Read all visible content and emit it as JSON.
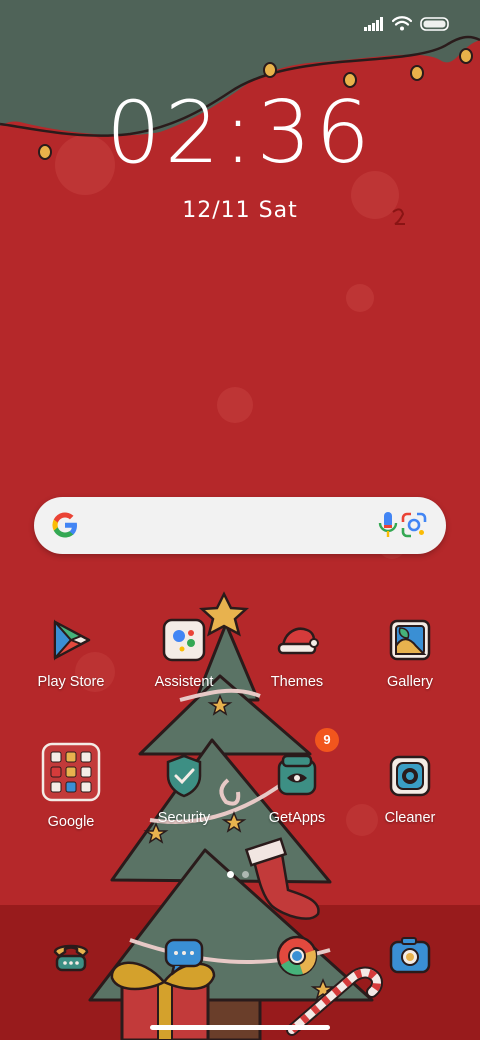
{
  "colors": {
    "wallpaper_red": "#b5282a",
    "wallpaper_dark_red": "#981b1c",
    "awning_green": "#4f6358",
    "tree_green": "#5a7365",
    "badge_orange": "#f2561d"
  },
  "status_bar": {
    "icons": [
      "signal-icon",
      "wifi-icon",
      "battery-icon"
    ]
  },
  "lock_clock": {
    "time": "02:36",
    "date": "12/11 Sat"
  },
  "search_bar": {
    "icons": [
      "google-logo-icon",
      "microphone-icon",
      "google-lens-icon"
    ]
  },
  "apps": [
    {
      "label": "Play Store",
      "icon": "play-store-icon"
    },
    {
      "label": "Assistent",
      "icon": "assistant-icon"
    },
    {
      "label": "Themes",
      "icon": "themes-santa-hat-icon"
    },
    {
      "label": "Gallery",
      "icon": "gallery-icon"
    },
    {
      "label": "Google",
      "icon": "google-folder-icon"
    },
    {
      "label": "Security",
      "icon": "security-shield-icon"
    },
    {
      "label": "GetApps",
      "icon": "getapps-icon",
      "badge": "9"
    },
    {
      "label": "Cleaner",
      "icon": "cleaner-icon"
    }
  ],
  "dock": [
    {
      "icon": "phone-icon"
    },
    {
      "icon": "messages-icon"
    },
    {
      "icon": "chrome-icon"
    },
    {
      "icon": "camera-icon"
    }
  ],
  "pager": {
    "pages": 2,
    "current": 1
  }
}
